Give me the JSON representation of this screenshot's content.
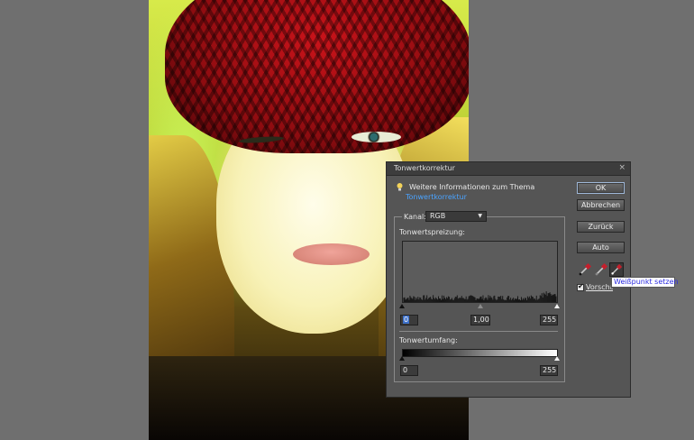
{
  "dialog": {
    "title": "Tonwertkorrektur",
    "close_glyph": "×",
    "info_text": "Weitere Informationen zum Thema",
    "info_link": "Tonwertkorrektur",
    "channel_label": "Kanal:",
    "channel_value": "RGB",
    "input_levels_label": "Tonwertspreizung:",
    "input_black": "0",
    "input_gamma": "1,00",
    "input_white": "255",
    "output_levels_label": "Tonwertumfang:",
    "output_black": "0",
    "output_white": "255",
    "buttons": {
      "ok": "OK",
      "cancel": "Abbrechen",
      "reset": "Zurück",
      "auto": "Auto"
    },
    "preview_label": "Vorschau",
    "preview_checked": true,
    "droppers": [
      "black-point-eyedropper-icon",
      "gray-point-eyedropper-icon",
      "white-point-eyedropper-icon"
    ]
  },
  "tooltip": {
    "text": "Weißpunkt setzen"
  },
  "colors": {
    "workspace": "#6f6f6f",
    "dialog_bg": "#555555",
    "link": "#4aa3ff",
    "tooltip_text": "#2a2ae0"
  }
}
